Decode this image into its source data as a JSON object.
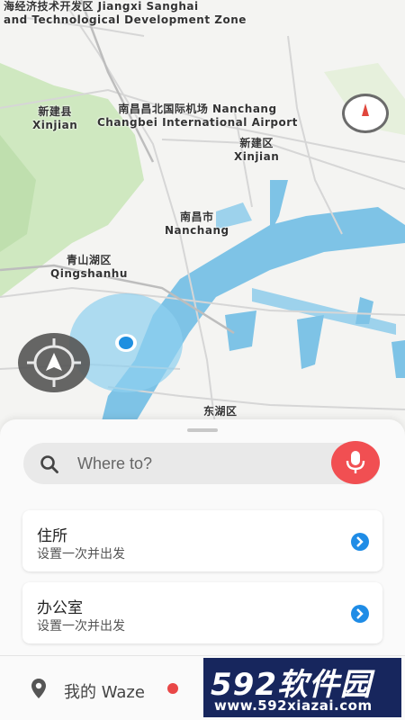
{
  "map": {
    "labels": {
      "zone_cn": "海经济技术开发区 Jiangxi Sanghai",
      "zone_en": "and Technological Development Zone",
      "xinjian1_cn": "新建县",
      "xinjian1_en": "Xinjian",
      "airport_cn": "南昌昌北国际机场 Nanchang",
      "airport_en": "Changbei International Airport",
      "xinjian2_cn": "新建区",
      "xinjian2_en": "Xinjian",
      "nanchang_cn": "南昌市",
      "nanchang_en": "Nanchang",
      "qingshanhu_cn": "青山湖区",
      "qingshanhu_en": "Qingshanhu",
      "donghu_cn": "东湖区"
    },
    "colors": {
      "water": "#7ec3e6",
      "park": "#cfe8c0",
      "road": "#d8d8d8",
      "accuracy": "#8fd0ef",
      "position": "#1e8fe0"
    }
  },
  "search": {
    "placeholder": "Where to?"
  },
  "favorites": [
    {
      "title": "住所",
      "subtitle": "设置一次并出发"
    },
    {
      "title": "办公室",
      "subtitle": "设置一次并出发"
    }
  ],
  "bottom": {
    "my_waze": "我的 Waze"
  },
  "watermark": {
    "big": "592软件园",
    "small": "www.592xiazai.com"
  }
}
